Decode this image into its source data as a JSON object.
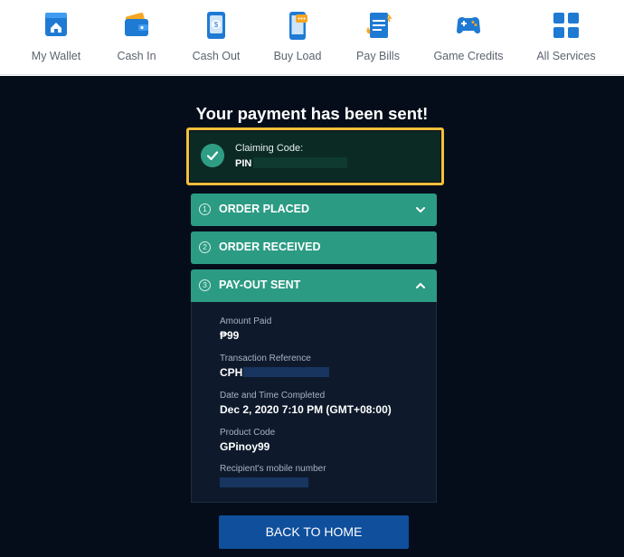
{
  "nav": [
    {
      "label": "My Wallet",
      "icon": "wallet-home-icon"
    },
    {
      "label": "Cash In",
      "icon": "cash-in-wallet-icon"
    },
    {
      "label": "Cash Out",
      "icon": "cash-out-icon"
    },
    {
      "label": "Buy Load",
      "icon": "phone-load-icon"
    },
    {
      "label": "Pay Bills",
      "icon": "bill-icon"
    },
    {
      "label": "Game Credits",
      "icon": "gamepad-icon"
    },
    {
      "label": "All Services",
      "icon": "grid-icon"
    }
  ],
  "title": "Your payment has been sent!",
  "claim": {
    "label": "Claiming Code:",
    "pin_prefix": "PIN"
  },
  "steps": [
    {
      "num": "1",
      "label": "ORDER PLACED",
      "state": "collapsed"
    },
    {
      "num": "2",
      "label": "ORDER RECEIVED",
      "state": "none"
    },
    {
      "num": "3",
      "label": "PAY-OUT SENT",
      "state": "expanded"
    }
  ],
  "details": {
    "amount_label": "Amount Paid",
    "amount_value": "₱99",
    "ref_label": "Transaction Reference",
    "ref_prefix": "CPH",
    "date_label": "Date and Time Completed",
    "date_value": "Dec 2, 2020 7:10 PM (GMT+08:00)",
    "product_label": "Product Code",
    "product_value": "GPinoy99",
    "mobile_label": "Recipient's mobile number"
  },
  "back_button": "BACK TO HOME",
  "colors": {
    "accent": "#2c9b83",
    "highlight": "#f4bf3a",
    "primary": "#0f4f9c",
    "background": "#050d1a"
  }
}
